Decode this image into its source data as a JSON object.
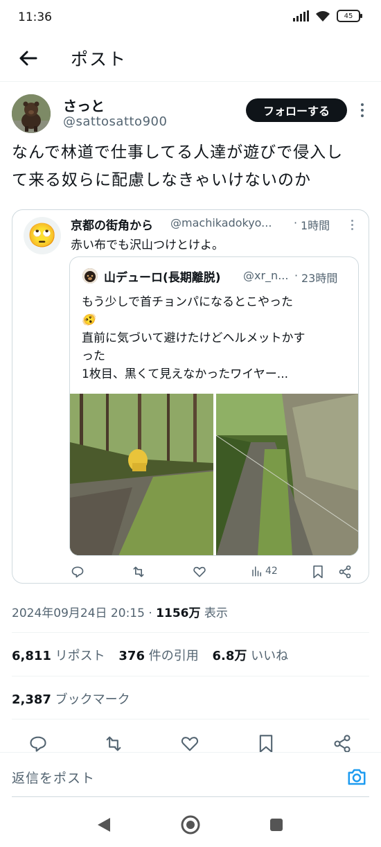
{
  "status_bar": {
    "time": "11:36",
    "battery": "45"
  },
  "header": {
    "title": "ポスト",
    "back_icon": "arrow-left-icon"
  },
  "post": {
    "author_name": "さっと",
    "author_handle": "@sattosatto900",
    "follow_label": "フォローする",
    "text_lines": [
      "なんで林道で仕事してる人達が遊びで侵入し",
      "て来る奴らに配慮しなきゃいけないのか"
    ],
    "timestamp": "2024年09月24日 20:15",
    "views_count": "1156万",
    "views_label": "表示",
    "reposts_count": "6,811",
    "reposts_label": "リポスト",
    "quotes_count": "376",
    "quotes_label": "件の引用",
    "likes_count": "6.8万",
    "likes_label": "いいね",
    "bookmarks_count": "2,387",
    "bookmarks_label": "ブックマーク"
  },
  "quote": {
    "avatar_emoji": "🙄",
    "name": "京都の街角から",
    "handle": "@machikadokyo...",
    "separator": "·",
    "time": "1時間",
    "text": "赤い布でも沢山つけとけよ。",
    "views": "42",
    "inner": {
      "name": "山デューロ(長期離脱)",
      "handle": "@xr_n...",
      "separator": "·",
      "time": "23時間",
      "lines": [
        "もう少しで首チョンパになるとこやった",
        "🫨",
        "直前に気づいて避けたけどヘルメットかす",
        "った",
        "1枚目、黒くて見えなかったワイヤー..."
      ]
    }
  },
  "reply": {
    "placeholder": "返信をポスト"
  },
  "colors": {
    "text": "#0f1419",
    "secondary": "#536471",
    "accent": "#1d9bf0",
    "border": "#cfd9de"
  }
}
